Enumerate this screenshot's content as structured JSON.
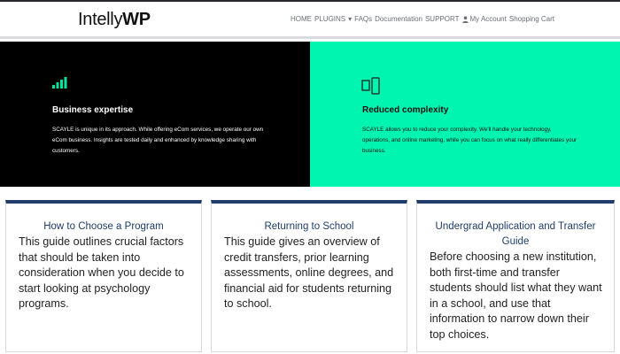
{
  "brand": {
    "logo_prefix": "Intelly",
    "logo_suffix": "WP"
  },
  "nav": {
    "home": "HOME",
    "plugins": "PLUGINS",
    "plugins_caret": "▾",
    "faqs": "FAQs",
    "documentation": "Documentation",
    "support": "SUPPORT",
    "my_account": "My Account",
    "shopping_cart": "Shopping Cart"
  },
  "features": [
    {
      "title": "Business expertise",
      "text": "SCAYLE is unique in its approach. While offering eCom services, we operate our own eCom business. Insights are tested daily and enhanced by knowledge sharing with customers.",
      "icon": "bar-chart-icon",
      "background": "#000000",
      "icon_color": "#00e6a0"
    },
    {
      "title": "Reduced complexity",
      "text": "SCAYLE allows you to reduce your complexity. We'll handle your technology, operations, and online marketing, while you can focus on what really differentiates your business.",
      "icon": "devices-icon",
      "background": "#00f5b0"
    }
  ],
  "cards": [
    {
      "title": "How to Choose a Program",
      "text": "This guide outlines crucial factors that should be taken into consideration when you decide to start looking at psychology programs."
    },
    {
      "title": "Returning to School",
      "text": "This guide gives an overview of credit transfers, prior learning assessments, online degrees, and financial aid for students returning to school."
    },
    {
      "title": "Undergrad Application and Transfer Guide",
      "text": "Before choosing a new institution, both first-time and transfer students should list what they want in a school, and use that information to narrow down their top choices."
    }
  ],
  "colors": {
    "accent_green": "#00f5b0",
    "card_title": "#1f3c6b",
    "dark_panel": "#000000"
  }
}
